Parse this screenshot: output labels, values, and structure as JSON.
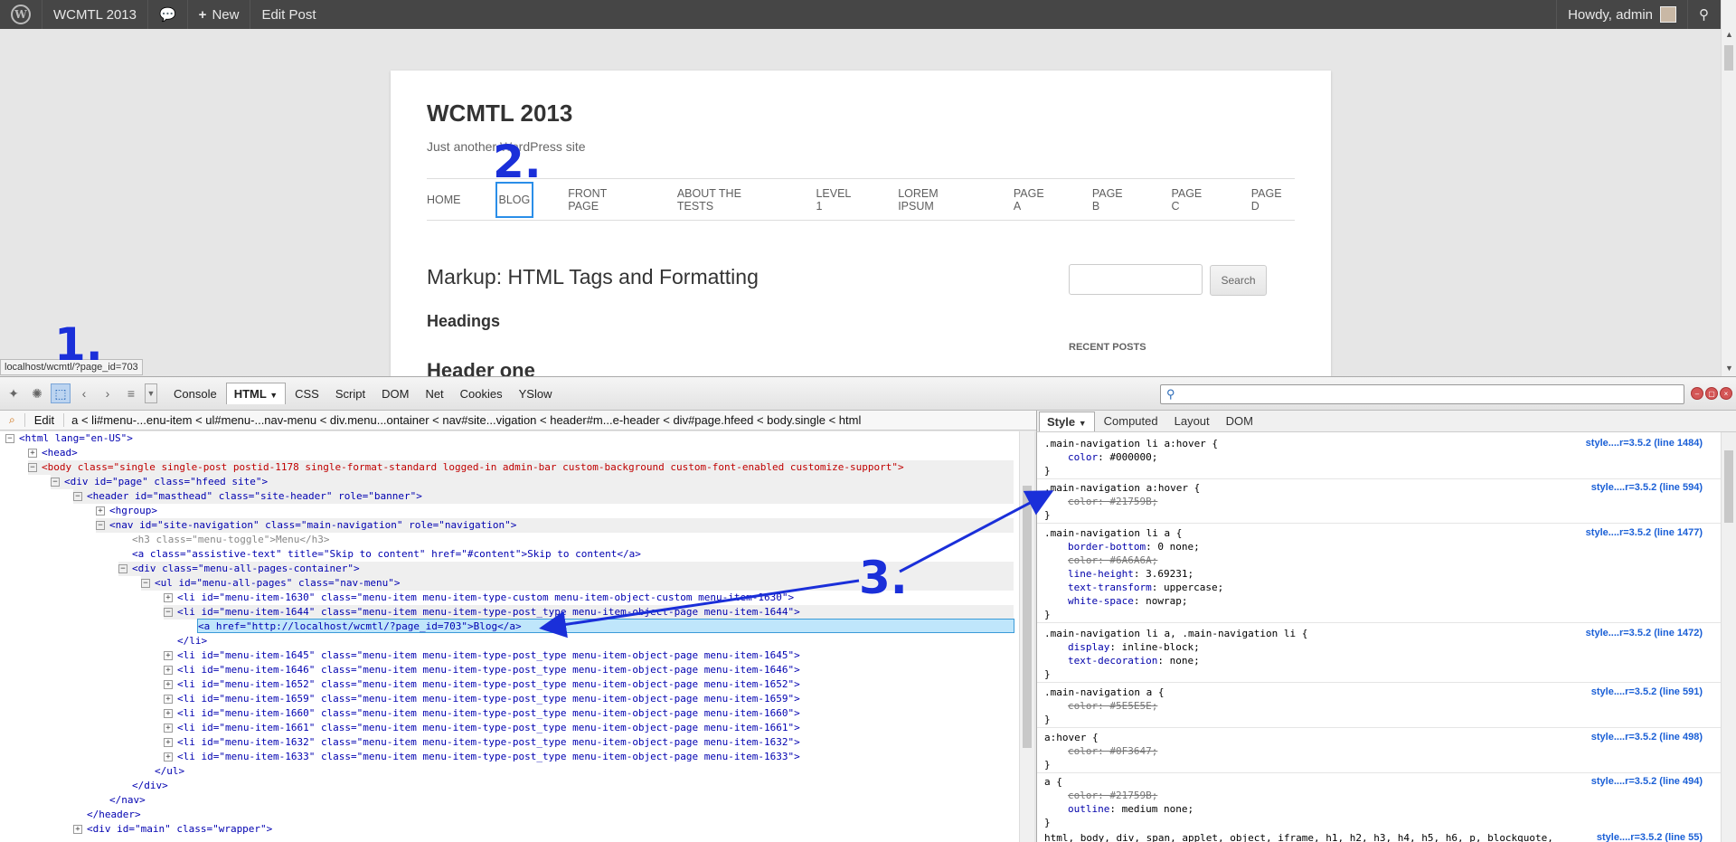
{
  "adminbar": {
    "site_name": "WCMTL 2013",
    "new_label": "New",
    "edit_post": "Edit Post",
    "howdy": "Howdy, admin"
  },
  "site": {
    "title": "WCMTL 2013",
    "description": "Just another WordPress site",
    "nav": [
      "HOME",
      "BLOG",
      "FRONT PAGE",
      "ABOUT THE TESTS",
      "LEVEL 1",
      "LOREM IPSUM",
      "PAGE A",
      "PAGE B",
      "PAGE C",
      "PAGE D"
    ],
    "entry_title": "Markup: HTML Tags and Formatting",
    "headings": "Headings",
    "header_one": "Header one",
    "search_button": "Search",
    "recent_posts": "RECENT POSTS"
  },
  "statusbar": "localhost/wcmtl/?page_id=703",
  "firebug": {
    "tabs": [
      "Console",
      "HTML",
      "CSS",
      "Script",
      "DOM",
      "Net",
      "Cookies",
      "YSlow"
    ],
    "active_tab": "HTML",
    "edit": "Edit",
    "breadcrumb": "a < li#menu-...enu-item < ul#menu-...nav-menu < div.menu...ontainer < nav#site...vigation < header#m...e-header < div#page.hfeed < body.single < html",
    "side_tabs": [
      "Style",
      "Computed",
      "Layout",
      "DOM"
    ],
    "active_side_tab": "Style"
  },
  "html_lines": [
    {
      "text": "<html lang=\"en-US\">"
    },
    {
      "text": "<head>"
    },
    {
      "text": "<body class=\"single single-post postid-1178 single-format-standard logged-in admin-bar custom-background custom-font-enabled customize-support\">"
    },
    {
      "text": "<div id=\"page\" class=\"hfeed site\">"
    },
    {
      "text": "<header id=\"masthead\" class=\"site-header\" role=\"banner\">"
    },
    {
      "text": "<hgroup>"
    },
    {
      "text": "<nav id=\"site-navigation\" class=\"main-navigation\" role=\"navigation\">"
    },
    {
      "text": "<h3 class=\"menu-toggle\">Menu</h3>"
    },
    {
      "text": "<a class=\"assistive-text\" title=\"Skip to content\" href=\"#content\">Skip to content</a>"
    },
    {
      "text": "<div class=\"menu-all-pages-container\">"
    },
    {
      "text": "<ul id=\"menu-all-pages\" class=\"nav-menu\">"
    },
    {
      "text": "<li id=\"menu-item-1630\" class=\"menu-item menu-item-type-custom menu-item-object-custom menu-item-1630\">"
    },
    {
      "text": "<li id=\"menu-item-1644\" class=\"menu-item menu-item-type-post_type menu-item-object-page menu-item-1644\">"
    },
    {
      "text": "<a href=\"http://localhost/wcmtl/?page_id=703\">Blog</a>"
    },
    {
      "text": "</li>"
    },
    {
      "text": "<li id=\"menu-item-1645\" class=\"menu-item menu-item-type-post_type menu-item-object-page menu-item-1645\">"
    },
    {
      "text": "<li id=\"menu-item-1646\" class=\"menu-item menu-item-type-post_type menu-item-object-page menu-item-1646\">"
    },
    {
      "text": "<li id=\"menu-item-1652\" class=\"menu-item menu-item-type-post_type menu-item-object-page menu-item-1652\">"
    },
    {
      "text": "<li id=\"menu-item-1659\" class=\"menu-item menu-item-type-post_type menu-item-object-page menu-item-1659\">"
    },
    {
      "text": "<li id=\"menu-item-1660\" class=\"menu-item menu-item-type-post_type menu-item-object-page menu-item-1660\">"
    },
    {
      "text": "<li id=\"menu-item-1661\" class=\"menu-item menu-item-type-post_type menu-item-object-page menu-item-1661\">"
    },
    {
      "text": "<li id=\"menu-item-1632\" class=\"menu-item menu-item-type-post_type menu-item-object-page menu-item-1632\">"
    },
    {
      "text": "<li id=\"menu-item-1633\" class=\"menu-item menu-item-type-post_type menu-item-object-page menu-item-1633\">"
    },
    {
      "text": "</ul>"
    },
    {
      "text": "</div>"
    },
    {
      "text": "</nav>"
    },
    {
      "text": "</header>"
    },
    {
      "text": "<div id=\"main\" class=\"wrapper\">"
    }
  ],
  "style_rules": [
    {
      "selector": ".main-navigation li a:hover {",
      "source": "style....r=3.5.2 (line 1484)",
      "props": [
        {
          "p": "color",
          "v": "#000000;",
          "strike": false
        }
      ]
    },
    {
      "selector": ".main-navigation a:hover {",
      "source": "style....r=3.5.2 (line 594)",
      "props": [
        {
          "p": "color",
          "v": "#21759B;",
          "strike": true
        }
      ]
    },
    {
      "selector": ".main-navigation li a {",
      "source": "style....r=3.5.2 (line 1477)",
      "props": [
        {
          "p": "border-bottom",
          "v": "0 none;",
          "strike": false
        },
        {
          "p": "color",
          "v": "#6A6A6A;",
          "strike": true
        },
        {
          "p": "line-height",
          "v": "3.69231;",
          "strike": false
        },
        {
          "p": "text-transform",
          "v": "uppercase;",
          "strike": false
        },
        {
          "p": "white-space",
          "v": "nowrap;",
          "strike": false
        }
      ]
    },
    {
      "selector": ".main-navigation li a, .main-navigation li {",
      "source": "style....r=3.5.2 (line 1472)",
      "props": [
        {
          "p": "display",
          "v": "inline-block;",
          "strike": false
        },
        {
          "p": "text-decoration",
          "v": "none;",
          "strike": false
        }
      ]
    },
    {
      "selector": ".main-navigation a {",
      "source": "style....r=3.5.2 (line 591)",
      "props": [
        {
          "p": "color",
          "v": "#5E5E5E;",
          "strike": true
        }
      ]
    },
    {
      "selector": "a:hover {",
      "source": "style....r=3.5.2 (line 498)",
      "props": [
        {
          "p": "color",
          "v": "#0F3647;",
          "strike": true
        }
      ]
    },
    {
      "selector": "a {",
      "source": "style....r=3.5.2 (line 494)",
      "props": [
        {
          "p": "color",
          "v": "#21759B;",
          "strike": true
        },
        {
          "p": "outline",
          "v": "medium none;",
          "strike": false
        }
      ]
    },
    {
      "selector": "html, body, div, span, applet, object, iframe, h1, h2, h3, h4, h5, h6, p, blockquote,",
      "source": "style....r=3.5.2 (line 55)",
      "props": []
    }
  ],
  "annotations": [
    "1.",
    "2.",
    "3."
  ],
  "colors": {
    "annotation": "#1a2fd9",
    "selected_row": "#bfe6fb",
    "link_blue": "#1a5fd6"
  }
}
